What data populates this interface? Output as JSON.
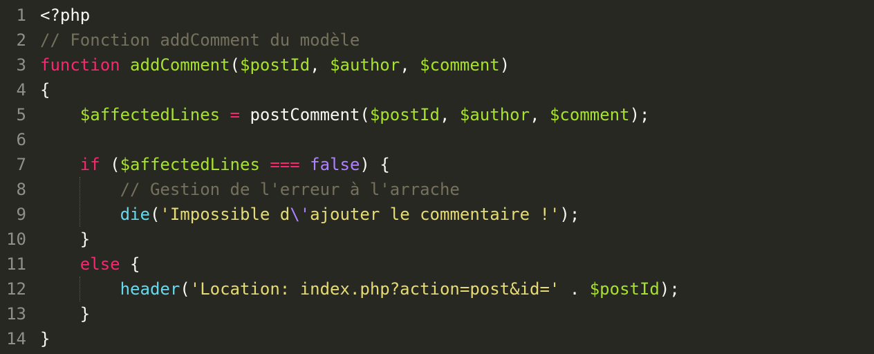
{
  "editor": {
    "theme": "Monokai",
    "colors": {
      "background": "#272822",
      "gutter_text": "#8f908a",
      "plain": "#f8f8f2",
      "comment": "#75715e",
      "keyword": "#f92672",
      "function_name": "#a6e22e",
      "builtin_call": "#66d9ef",
      "variable": "#a6e22e",
      "constant": "#ae81ff",
      "string": "#e6db74"
    },
    "lines": [
      {
        "number": "1",
        "indent": "",
        "tokens": [
          {
            "t": "plain",
            "v": "<?php"
          }
        ]
      },
      {
        "number": "2",
        "indent": "",
        "tokens": [
          {
            "t": "comment",
            "v": "// Fonction addComment du modèle"
          }
        ]
      },
      {
        "number": "3",
        "indent": "",
        "tokens": [
          {
            "t": "keyword",
            "v": "function"
          },
          {
            "t": "plain",
            "v": " "
          },
          {
            "t": "function",
            "v": "addComment"
          },
          {
            "t": "plain",
            "v": "("
          },
          {
            "t": "variable",
            "v": "$postId"
          },
          {
            "t": "plain",
            "v": ", "
          },
          {
            "t": "variable",
            "v": "$author"
          },
          {
            "t": "plain",
            "v": ", "
          },
          {
            "t": "variable",
            "v": "$comment"
          },
          {
            "t": "plain",
            "v": ")"
          }
        ]
      },
      {
        "number": "4",
        "indent": "",
        "tokens": [
          {
            "t": "plain",
            "v": "{"
          }
        ]
      },
      {
        "number": "5",
        "indent": "    ",
        "tokens": [
          {
            "t": "variable",
            "v": "$affectedLines"
          },
          {
            "t": "plain",
            "v": " "
          },
          {
            "t": "operator",
            "v": "="
          },
          {
            "t": "plain",
            "v": " "
          },
          {
            "t": "plain",
            "v": "postComment("
          },
          {
            "t": "variable",
            "v": "$postId"
          },
          {
            "t": "plain",
            "v": ", "
          },
          {
            "t": "variable",
            "v": "$author"
          },
          {
            "t": "plain",
            "v": ", "
          },
          {
            "t": "variable",
            "v": "$comment"
          },
          {
            "t": "plain",
            "v": ");"
          }
        ]
      },
      {
        "number": "6",
        "indent": "",
        "tokens": []
      },
      {
        "number": "7",
        "indent": "    ",
        "tokens": [
          {
            "t": "keyword",
            "v": "if"
          },
          {
            "t": "plain",
            "v": " ("
          },
          {
            "t": "variable",
            "v": "$affectedLines"
          },
          {
            "t": "plain",
            "v": " "
          },
          {
            "t": "operator",
            "v": "==="
          },
          {
            "t": "plain",
            "v": " "
          },
          {
            "t": "constant",
            "v": "false"
          },
          {
            "t": "plain",
            "v": ") {"
          }
        ]
      },
      {
        "number": "8",
        "indent": "        ",
        "tokens": [
          {
            "t": "comment",
            "v": "// Gestion de l'erreur à l'arrache"
          }
        ]
      },
      {
        "number": "9",
        "indent": "        ",
        "tokens": [
          {
            "t": "call",
            "v": "die"
          },
          {
            "t": "plain",
            "v": "("
          },
          {
            "t": "string",
            "v": "'Impossible d"
          },
          {
            "t": "escape",
            "v": "\\'"
          },
          {
            "t": "string",
            "v": "ajouter le commentaire !'"
          },
          {
            "t": "plain",
            "v": ");"
          }
        ]
      },
      {
        "number": "10",
        "indent": "    ",
        "tokens": [
          {
            "t": "plain",
            "v": "}"
          }
        ]
      },
      {
        "number": "11",
        "indent": "    ",
        "tokens": [
          {
            "t": "keyword",
            "v": "else"
          },
          {
            "t": "plain",
            "v": " {"
          }
        ]
      },
      {
        "number": "12",
        "indent": "        ",
        "tokens": [
          {
            "t": "call",
            "v": "header"
          },
          {
            "t": "plain",
            "v": "("
          },
          {
            "t": "string",
            "v": "'Location: index.php?action=post&id='"
          },
          {
            "t": "plain",
            "v": " . "
          },
          {
            "t": "variable",
            "v": "$postId"
          },
          {
            "t": "plain",
            "v": ");"
          }
        ]
      },
      {
        "number": "13",
        "indent": "    ",
        "tokens": [
          {
            "t": "plain",
            "v": "}"
          }
        ]
      },
      {
        "number": "14",
        "indent": "",
        "tokens": [
          {
            "t": "plain",
            "v": "}"
          }
        ]
      }
    ]
  }
}
